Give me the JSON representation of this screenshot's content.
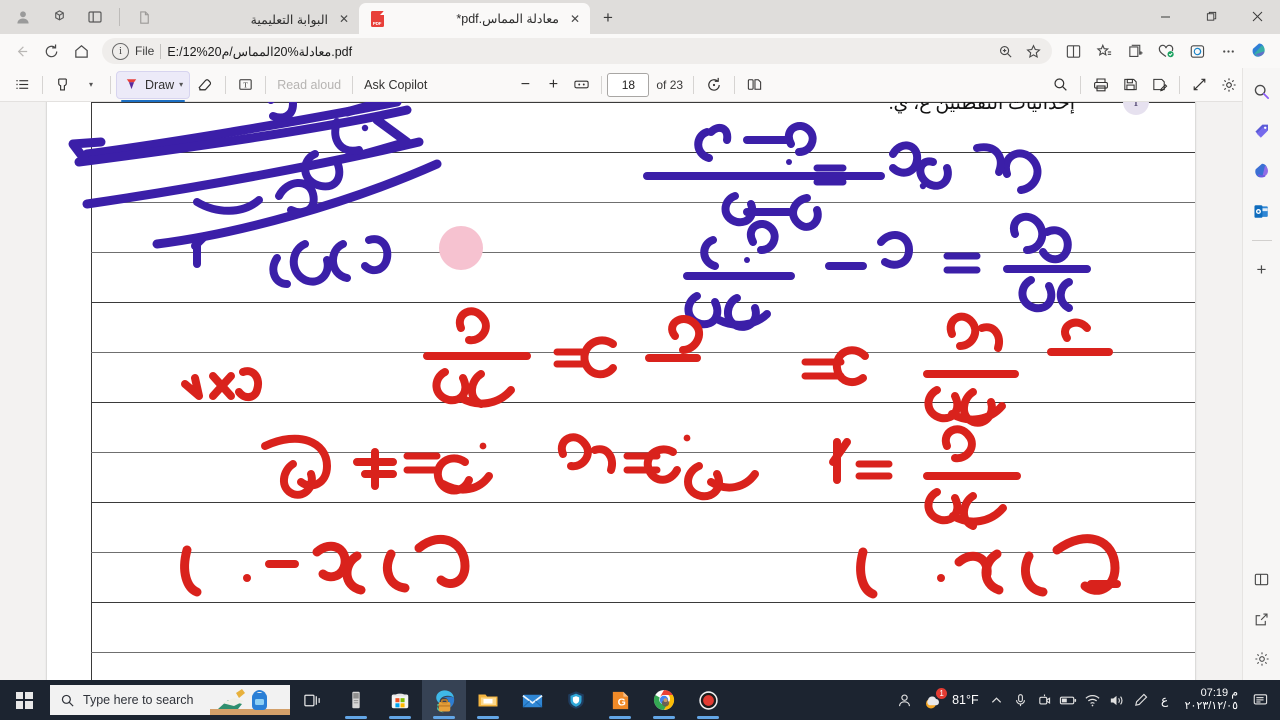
{
  "browser": {
    "tabs": [
      {
        "title": "البوابة التعليمية",
        "active": false,
        "favicon": "generic-page-icon"
      },
      {
        "title": "معادلة المماس.pdf*",
        "active": true,
        "favicon": "pdf-icon"
      }
    ],
    "new_tab_label": "+",
    "window_controls": {
      "minimize": "—",
      "maximize": "❐",
      "close": "✕"
    },
    "toolbar_left_icons": [
      "profile-icon",
      "tab-actions-icon",
      "tab-pane-icon",
      "new-page-icon"
    ],
    "address": {
      "scheme_label": "File",
      "url": "E:/12%20معادلة%20المماس/م.pdf",
      "info_icon": "i"
    },
    "address_right_icons": [
      "zoom-icon",
      "favorite-star-icon"
    ],
    "bar_right_icons": [
      "split-screen-icon",
      "favorites-icon",
      "collections-icon",
      "browser-essentials-icon",
      "profile-browser-icon",
      "settings-more-icon",
      "copilot-icon"
    ]
  },
  "pdf_toolbar": {
    "toc_label": "table-of-contents",
    "highlight_label": "highlight",
    "draw_label": "Draw",
    "erase_label": "erase",
    "text_label": "add-text",
    "read_aloud_label": "Read aloud",
    "copilot_label": "Ask Copilot",
    "zoom_out": "−",
    "zoom_in": "+",
    "fit_page": "fit-to-page",
    "page_current": "18",
    "page_total": "of 23",
    "rotate_label": "rotate",
    "layout_label": "page-layout",
    "right_icons": [
      "search-icon",
      "print-icon",
      "save-icon",
      "save-as-icon",
      "fullscreen-icon",
      "settings-icon"
    ]
  },
  "document": {
    "header_text": "إحداثيات النقطتَين ع، ي.",
    "info_badge": "i",
    "ink_note": "handwritten-annotations",
    "cursor": "pink-pen-cursor"
  },
  "sidebar": {
    "items": [
      {
        "name": "search-icon",
        "glyph": "🔍"
      },
      {
        "name": "shopping-tag-icon",
        "glyph": "🏷"
      },
      {
        "name": "copilot-icon",
        "glyph": "◈"
      },
      {
        "name": "outlook-icon",
        "glyph": "✉"
      },
      {
        "name": "add-sidebar-icon",
        "glyph": "+"
      }
    ],
    "bottom_items": [
      {
        "name": "split-pane-icon",
        "glyph": "▣"
      },
      {
        "name": "open-external-icon",
        "glyph": "↗"
      },
      {
        "name": "settings-gear-icon",
        "glyph": "⚙"
      }
    ]
  },
  "taskbar": {
    "start_label": "start-button",
    "search_placeholder": "Type here to search",
    "task_view_label": "task-view",
    "apps": [
      {
        "name": "usb-drive-icon",
        "active": false,
        "running": true
      },
      {
        "name": "microsoft-store-icon",
        "active": false,
        "running": true
      },
      {
        "name": "microsoft-edge-icon",
        "active": true,
        "running": true
      },
      {
        "name": "file-explorer-icon",
        "active": false,
        "running": true
      },
      {
        "name": "mail-icon",
        "active": false,
        "running": false
      },
      {
        "name": "vpn-shield-icon",
        "active": false,
        "running": false
      },
      {
        "name": "pdf-app-icon",
        "active": false,
        "running": true
      },
      {
        "name": "google-chrome-icon",
        "active": false,
        "running": true
      },
      {
        "name": "screen-recorder-icon",
        "active": false,
        "running": true
      }
    ],
    "tray": {
      "hidden_icons_label": "^",
      "weather_temp": "81°F",
      "weather_badge": "1",
      "mic_icon": "microphone-icon",
      "camera_icon": "camera-icon",
      "battery_icon": "battery-icon",
      "wifi_icon": "wifi-icon",
      "volume_icon": "volume-icon",
      "pen_icon": "pen-icon",
      "language": "ع",
      "time": "07:19 م",
      "date": "٢٠٢٣/١٢/٠٥",
      "notifications_icon": "notifications-icon"
    }
  },
  "colors": {
    "ink_purple": "#3b1fa8",
    "ink_red": "#d9221c",
    "cursor_pink": "#f6c2d0",
    "accent_blue": "#1b6ec2",
    "taskbar": "#1c2430"
  }
}
